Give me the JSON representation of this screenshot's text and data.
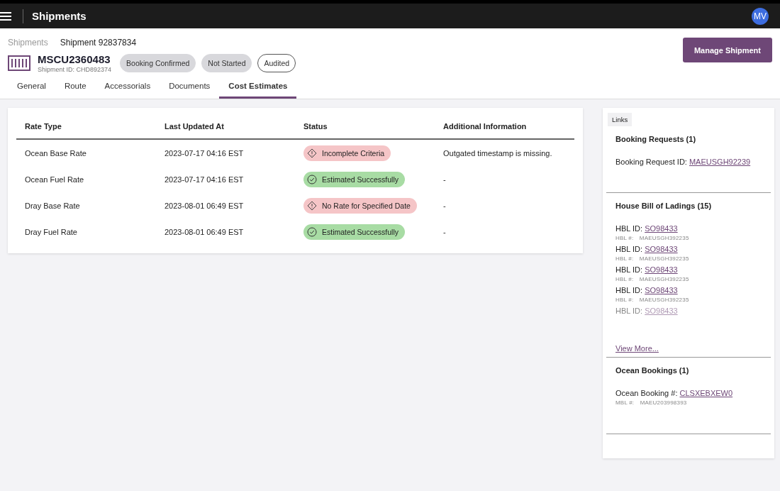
{
  "app_bar": {
    "title": "Shipments",
    "avatar": "MV"
  },
  "breadcrumbs": [
    "Shipments",
    "Shipment 92837834"
  ],
  "shipment": {
    "container": "MSCU2360483",
    "shipment_id": "Shipment ID: CHD892374",
    "badges": [
      {
        "label": "Booking Confirmed",
        "kind": "filled"
      },
      {
        "label": "Not Started",
        "kind": "filled"
      },
      {
        "label": "Audited",
        "kind": "outline"
      }
    ]
  },
  "manage_button": "Manage Shipment",
  "tabs": [
    {
      "label": "General",
      "selected": false
    },
    {
      "label": "Route",
      "selected": false
    },
    {
      "label": "Accessorials",
      "selected": false
    },
    {
      "label": "Documents",
      "selected": false
    },
    {
      "label": "Cost Estimates",
      "selected": true
    }
  ],
  "table": {
    "columns": [
      "Rate Type",
      "Last Updated At",
      "Status",
      "Additional Information"
    ],
    "rows": [
      {
        "rate_type": "Ocean Base Rate",
        "updated": "2023-07-17 04:16 EST",
        "status": {
          "label": "Incomplete Criteria",
          "kind": "error"
        },
        "info": "Outgated timestamp is missing."
      },
      {
        "rate_type": "Ocean Fuel Rate",
        "updated": "2023-07-17 04:16 EST",
        "status": {
          "label": "Estimated Successfully",
          "kind": "success"
        },
        "info": "-"
      },
      {
        "rate_type": "Dray Base Rate",
        "updated": "2023-08-01 06:49 EST",
        "status": {
          "label": "No Rate for Specified Date",
          "kind": "error"
        },
        "info": "-"
      },
      {
        "rate_type": "Dray Fuel Rate",
        "updated": "2023-08-01 06:49 EST",
        "status": {
          "label": "Estimated Successfully",
          "kind": "success"
        },
        "info": "-"
      }
    ]
  },
  "links": {
    "tag": "Links",
    "sections": [
      {
        "title": "Booking Requests (1)",
        "items": [
          {
            "label": "Booking Request ID:",
            "link": "MAEUSGH92239"
          }
        ]
      },
      {
        "title": "House Bill of Ladings (15)",
        "items": [
          {
            "label": "HBL ID:",
            "link": "SO98433",
            "sub_label": "HBL #:",
            "sub_value": "MAEUSGH392235"
          },
          {
            "label": "HBL ID:",
            "link": "SO98433",
            "sub_label": "HBL #:",
            "sub_value": "MAEUSGH392235"
          },
          {
            "label": "HBL ID:",
            "link": "SO98433",
            "sub_label": "HBL #:",
            "sub_value": "MAEUSGH392235"
          },
          {
            "label": "HBL ID:",
            "link": "SO98433",
            "sub_label": "HBL #:",
            "sub_value": "MAEUSGH392235"
          },
          {
            "label": "HBL ID:",
            "link": "SO98433",
            "faded": true
          }
        ],
        "more": "View More..."
      },
      {
        "title": "Ocean Bookings (1)",
        "items": [
          {
            "label": "Ocean Booking #:",
            "link": "CLSXEBXEW0",
            "sub_label": "MBL #:",
            "sub_value": "MAEU203998393"
          }
        ]
      }
    ]
  }
}
